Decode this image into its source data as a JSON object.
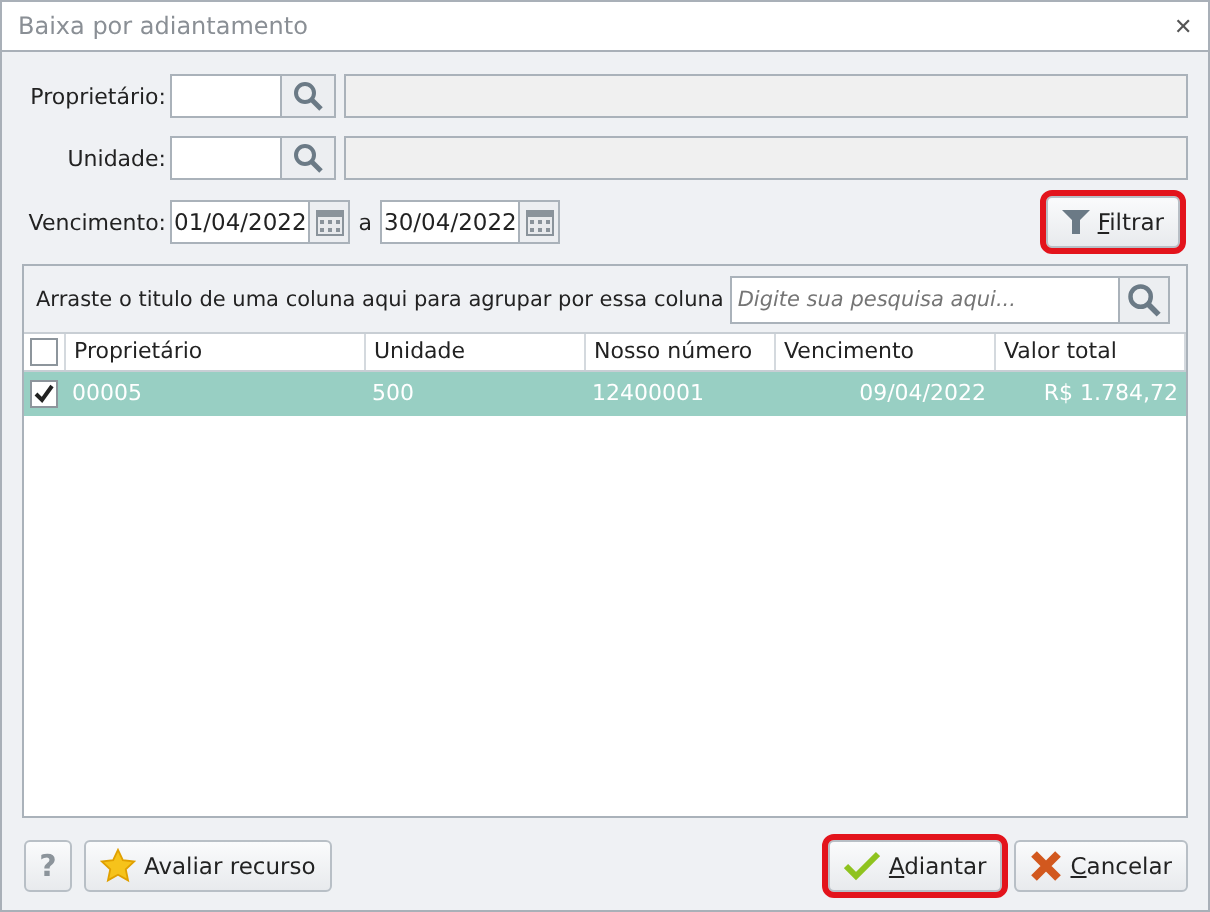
{
  "window": {
    "title": "Baixa por adiantamento",
    "close": "✕"
  },
  "filters": [
    {
      "label": "Proprietário:"
    },
    {
      "label": "Unidade:"
    }
  ],
  "due": {
    "label": "Vencimento:",
    "from": "01/04/2022",
    "separator": "a",
    "to": "30/04/2022"
  },
  "filter_button": {
    "label": "Filtrar",
    "highlighted": true
  },
  "grid": {
    "group_hint": "Arraste o titulo de uma coluna aqui para agrupar por essa coluna",
    "search": {
      "placeholder": "Digite sua pesquisa aqui..."
    },
    "all_checked": false,
    "columns": [
      {
        "label": "Proprietário"
      },
      {
        "label": "Unidade"
      },
      {
        "label": "Nosso número"
      },
      {
        "label": "Vencimento"
      },
      {
        "label": "Valor total"
      }
    ],
    "rows": [
      {
        "selected": true,
        "checked": true,
        "cells": [
          "00005",
          "500",
          "12400001",
          "09/04/2022",
          "R$ 1.784,72"
        ]
      }
    ]
  },
  "footer": {
    "help": "?",
    "rate": "Avaliar recurso",
    "confirm": {
      "label": "Adiantar",
      "highlighted": true
    },
    "cancel": {
      "label": "Cancelar",
      "highlighted": false
    }
  }
}
